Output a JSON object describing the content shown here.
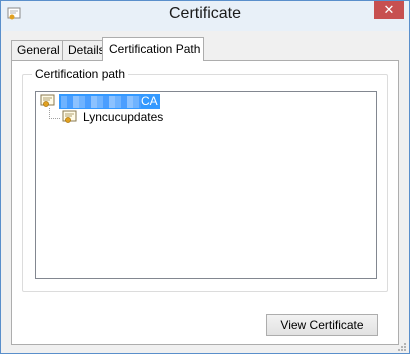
{
  "window": {
    "title": "Certificate",
    "close_glyph": "✕"
  },
  "tabs": [
    {
      "label": "General",
      "active": false
    },
    {
      "label": "Details",
      "active": false
    },
    {
      "label": "Certification Path",
      "active": true
    }
  ],
  "certification_path": {
    "group_label": "Certification path",
    "tree": [
      {
        "label_suffix": "CA",
        "selected": true,
        "label_obscured": true,
        "icon": "certificate-icon"
      },
      {
        "label": "Lyncucupdates",
        "selected": false,
        "icon": "certificate-icon"
      }
    ],
    "view_button_label": "View Certificate"
  },
  "colors": {
    "selection": "#3399ff",
    "close_button": "#c75050",
    "window_border": "#5a8fcb"
  }
}
